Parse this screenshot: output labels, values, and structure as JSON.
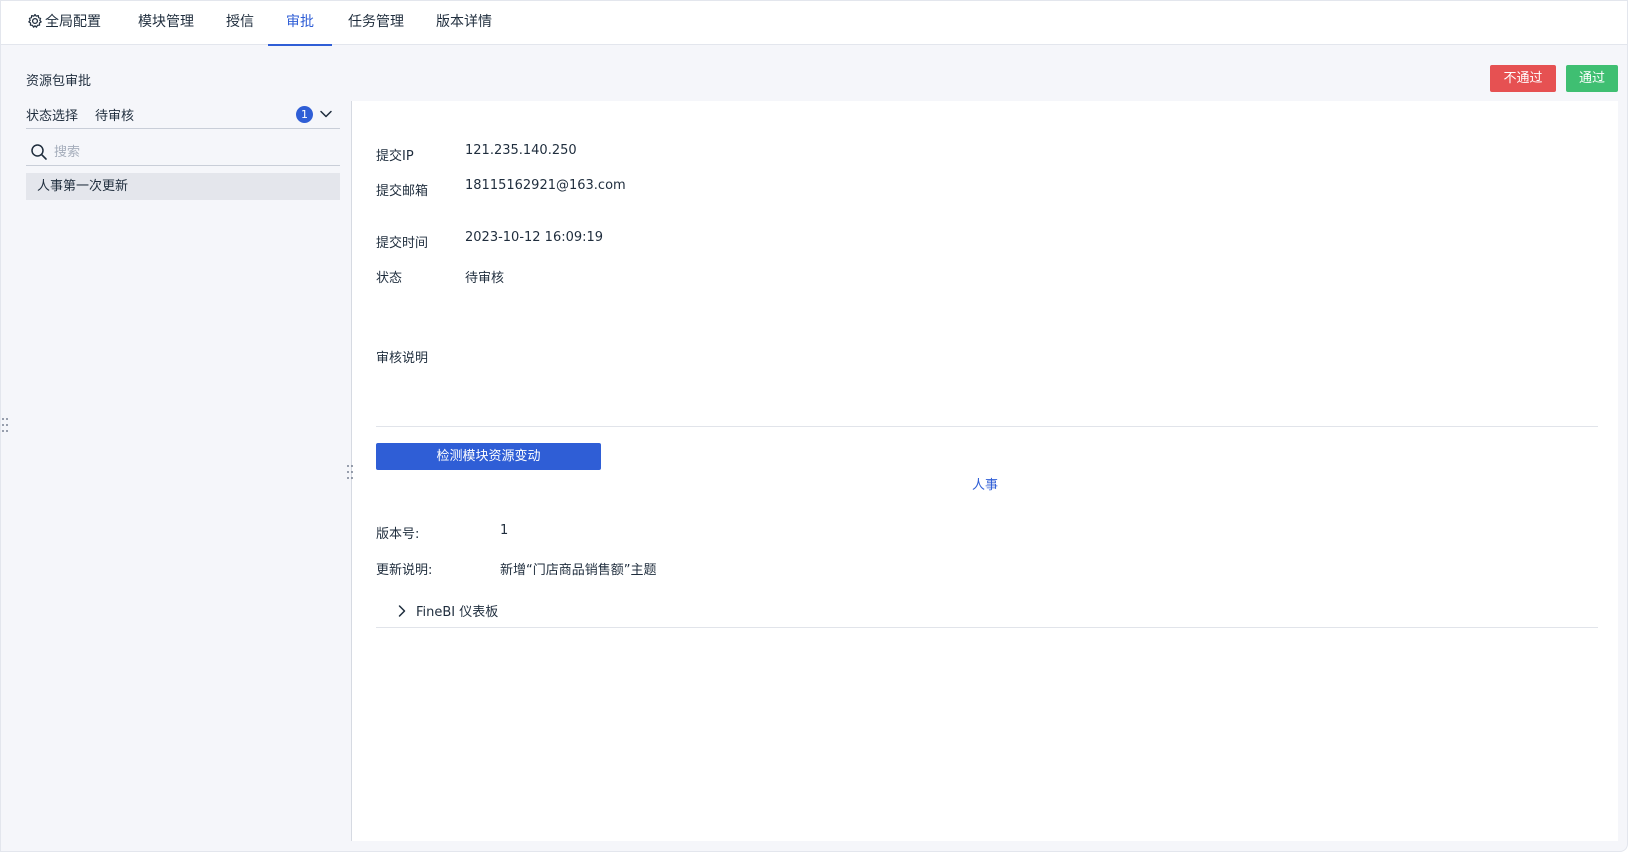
{
  "nav": {
    "tabs": [
      {
        "label": "全局配置",
        "icon": "gear-icon"
      },
      {
        "label": "模块管理"
      },
      {
        "label": "授信"
      },
      {
        "label": "审批",
        "active": true
      },
      {
        "label": "任务管理"
      },
      {
        "label": "版本详情"
      }
    ]
  },
  "page": {
    "title": "资源包审批",
    "reject_label": "不通过",
    "pass_label": "通过"
  },
  "filter": {
    "status_label": "状态选择",
    "status_value": "待审核",
    "status_count": "1",
    "search_placeholder": "搜索"
  },
  "list": {
    "items": [
      "人事第一次更新"
    ]
  },
  "detail": {
    "ip_label": "提交IP",
    "ip_value": "121.235.140.250",
    "email_label": "提交邮箱",
    "email_value": "18115162921@163.com",
    "time_label": "提交时间",
    "time_value": "2023-10-12 16:09:19",
    "state_label": "状态",
    "state_value": "待审核",
    "review_label": "审核说明",
    "detect_button": "检测模块资源变动",
    "module_name": "人事",
    "version_label": "版本号:",
    "version_value": "1",
    "update_label": "更新说明:",
    "update_value": "新增“门店商品销售额”主题",
    "resource_group": "FineBI 仪表板"
  },
  "colors": {
    "primary": "#2f5ed6",
    "danger": "#e65152",
    "success": "#3fbf72"
  }
}
